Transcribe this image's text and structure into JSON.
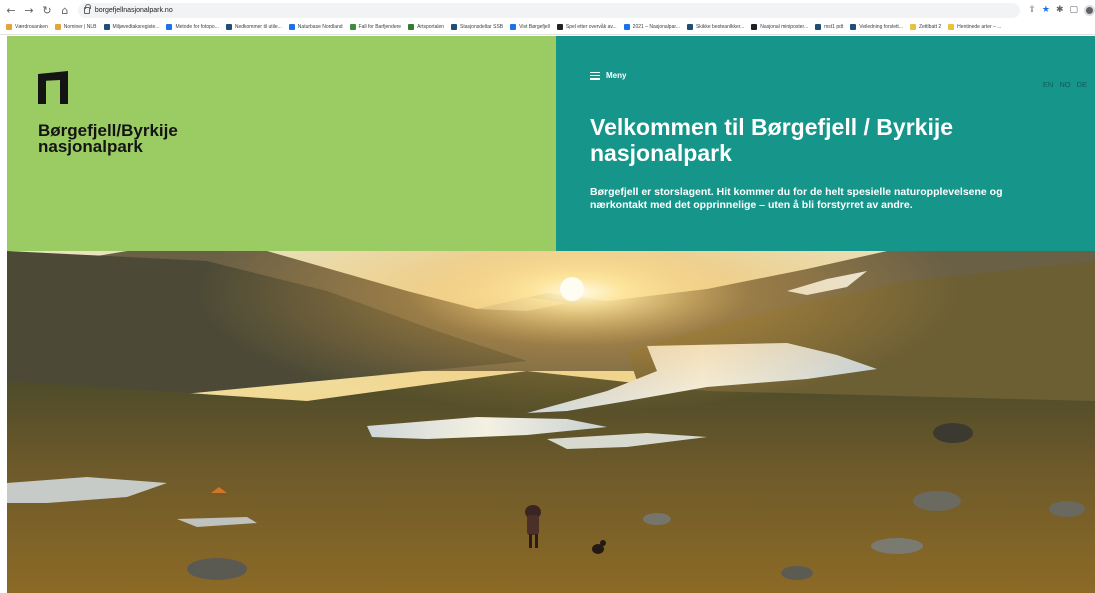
{
  "browser": {
    "url": "borgefjellnasjonalpark.no",
    "bookmarks": [
      {
        "label": "Værdrosanken",
        "color": "#e8a23b"
      },
      {
        "label": "Nominer | NLB",
        "color": "#e8a23b"
      },
      {
        "label": "Miljøvedtaksregiste...",
        "color": "#1f4e79"
      },
      {
        "label": "Metode for fotopo...",
        "color": "#1a73e8"
      },
      {
        "label": "Nedkommer til utile...",
        "color": "#1f4e79"
      },
      {
        "label": "Naturbase Nordland",
        "color": "#1a73e8"
      },
      {
        "label": "Fall for Barfjendere",
        "color": "#3c8c3c"
      },
      {
        "label": "Artsportalen",
        "color": "#2e7d32"
      },
      {
        "label": "Stasjonsdeltar SSB",
        "color": "#1f4e79"
      },
      {
        "label": "Vist Børgefjell",
        "color": "#1a73e8"
      },
      {
        "label": "Spel etter overvåk av...",
        "color": "#202124"
      },
      {
        "label": "2021 – Nasjonalpar...",
        "color": "#1a73e8"
      },
      {
        "label": "Skikke besteanlkker...",
        "color": "#1f4e79"
      },
      {
        "label": "Nasjonal miniposter...",
        "color": "#202124"
      },
      {
        "label": "mst1 pdt",
        "color": "#1f4e79"
      },
      {
        "label": "Veiledning forslett...",
        "color": "#1f4e79"
      },
      {
        "label": "Zettlbatt 2",
        "color": "#e8c23b"
      },
      {
        "label": "Hentinede arter – ...",
        "color": "#e8c23b"
      }
    ]
  },
  "site": {
    "brand_line1": "Børgefjell/Byrkije",
    "brand_line2": "nasjonalpark",
    "menu_label": "Meny",
    "languages": [
      "EN",
      "NO",
      "DE"
    ],
    "headline": "Velkommen til Børgefjell / Byrkije nasjonalpark",
    "lead": "Børgefjell er storslagent. Hit kommer du for de helt spesielle naturopplevelsene og nærkontakt med det opprinnelige – uten å bli forstyrret av andre."
  },
  "colors": {
    "green_panel": "#9bcc63",
    "teal_panel": "#16968a",
    "logo": "#141414"
  },
  "icons": {
    "back": "arrow-left-icon",
    "forward": "arrow-right-icon",
    "reload": "reload-icon",
    "home": "home-icon",
    "menu": "hamburger-icon"
  }
}
